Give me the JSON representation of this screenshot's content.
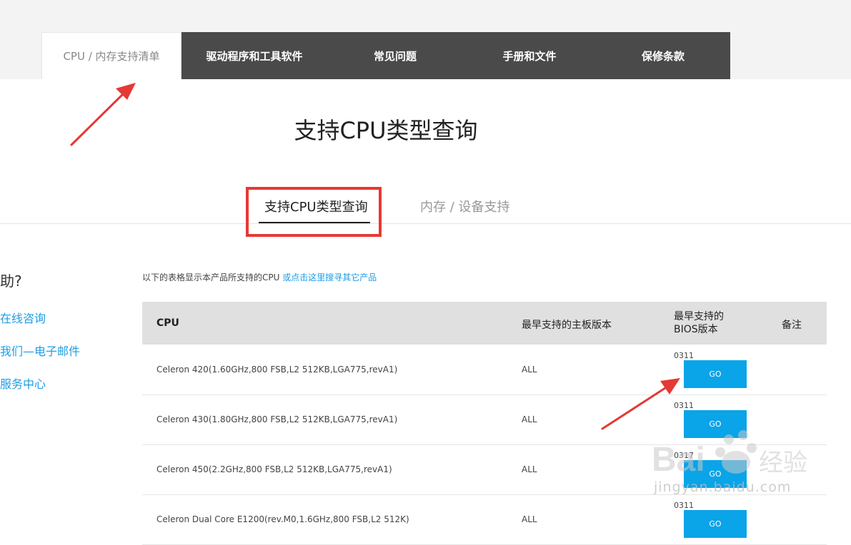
{
  "nav": {
    "tabs": [
      {
        "label": "CPU / 内存支持清单"
      },
      {
        "label": "驱动程序和工具软件"
      },
      {
        "label": "常见问题"
      },
      {
        "label": "手册和文件"
      },
      {
        "label": "保修条款"
      }
    ]
  },
  "page_title": "支持CPU类型查询",
  "subtabs": [
    {
      "label": "支持CPU类型查询"
    },
    {
      "label": "内存 / 设备支持"
    }
  ],
  "sidebar": {
    "question": "助?",
    "links": [
      "在线咨询",
      "我们—电子邮件",
      "服务中心"
    ]
  },
  "intro": {
    "text": "以下的表格显示本产品所支持的CPU",
    "link": "或点击这里搜寻其它产品"
  },
  "table": {
    "headers": {
      "cpu": "CPU",
      "board": "最早支持的主板版本",
      "bios_line1": "最早支持的",
      "bios_line2": "BIOS版本",
      "note": "备注"
    },
    "rows": [
      {
        "cpu": "Celeron 420(1.60GHz,800 FSB,L2 512KB,LGA775,revA1)",
        "board": "ALL",
        "bios": "0311",
        "go": "GO"
      },
      {
        "cpu": "Celeron 430(1.80GHz,800 FSB,L2 512KB,LGA775,revA1)",
        "board": "ALL",
        "bios": "0311",
        "go": "GO"
      },
      {
        "cpu": "Celeron 450(2.2GHz,800 FSB,L2 512KB,LGA775,revA1)",
        "board": "ALL",
        "bios": "0317",
        "go": "GO"
      },
      {
        "cpu": "Celeron Dual Core E1200(rev.M0,1.6GHz,800 FSB,L2 512K)",
        "board": "ALL",
        "bios": "0311",
        "go": "GO"
      }
    ]
  },
  "watermark": {
    "text": "jingyan.baidu.com"
  },
  "colors": {
    "accent": "#0aa4e8",
    "nav_bg": "#4a4a4a",
    "annotation": "#e53935",
    "link": "#1e9ce6"
  }
}
